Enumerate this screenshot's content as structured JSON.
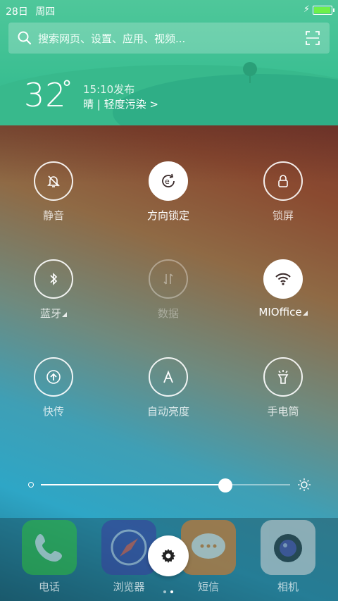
{
  "status_bar": {
    "date": "28日",
    "weekday": "周四",
    "battery_percent": 95
  },
  "search": {
    "placeholder": "搜索网页、设置、应用、视频..."
  },
  "weather": {
    "temperature": "32",
    "unit": "°",
    "published": "15:10发布",
    "condition": "晴 | 轻度污染 >"
  },
  "tiles": [
    {
      "label": "静音",
      "icon": "bell-off-icon",
      "state": "off"
    },
    {
      "label": "方向锁定",
      "icon": "rotation-lock-icon",
      "state": "on"
    },
    {
      "label": "锁屏",
      "icon": "lock-icon",
      "state": "off"
    },
    {
      "label": "蓝牙",
      "icon": "bluetooth-icon",
      "state": "off",
      "has_more": true
    },
    {
      "label": "数据",
      "icon": "mobile-data-icon",
      "state": "disabled"
    },
    {
      "label": "MIOffice",
      "icon": "wifi-icon",
      "state": "on",
      "has_more": true
    },
    {
      "label": "快传",
      "icon": "quick-transfer-icon",
      "state": "off"
    },
    {
      "label": "自动亮度",
      "icon": "auto-brightness-icon",
      "state": "off"
    },
    {
      "label": "手电筒",
      "icon": "flashlight-icon",
      "state": "off"
    }
  ],
  "brightness": {
    "level": 0.74
  },
  "dock": [
    {
      "label": "电话",
      "icon": "phone-icon",
      "color": "#2fbf3a"
    },
    {
      "label": "浏览器",
      "icon": "compass-icon",
      "color": "#3a3aa0"
    },
    {
      "label": "短信",
      "icon": "message-icon",
      "color": "#f27a1a"
    },
    {
      "label": "相机",
      "icon": "camera-icon",
      "color": "#d8d8d8"
    }
  ],
  "page_indicator": {
    "pages": 2,
    "current": 2
  }
}
